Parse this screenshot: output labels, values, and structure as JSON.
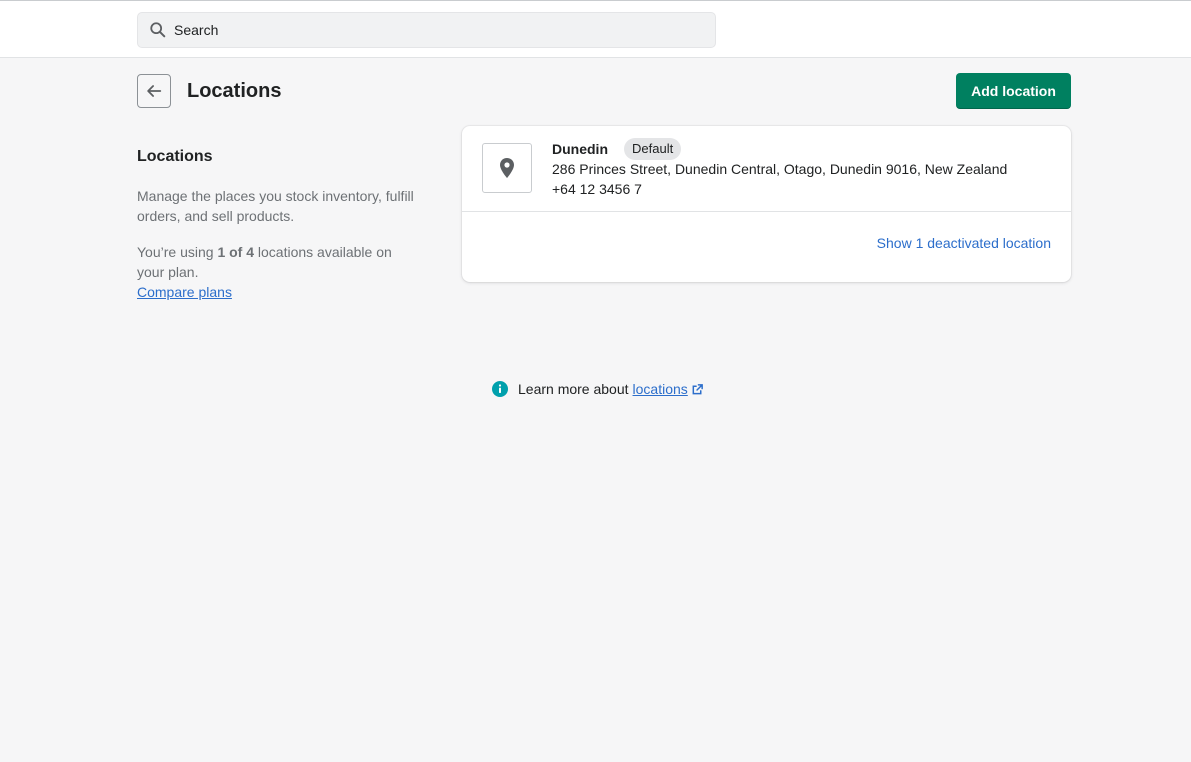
{
  "topbar": {
    "search": {
      "placeholder": "Search",
      "icon": "search-icon"
    }
  },
  "header": {
    "back_icon": "arrow-left-icon",
    "title": "Locations",
    "add_button_label": "Add location"
  },
  "sidebar_info": {
    "heading": "Locations",
    "description": "Manage the places you stock inventory, fulfill orders, and sell products.",
    "usage_prefix": "You’re using ",
    "usage_count": "1 of 4",
    "usage_suffix": " locations available on your plan.",
    "compare_link": "Compare plans"
  },
  "locations": [
    {
      "name": "Dunedin",
      "badge": "Default",
      "address": "286 Princes Street, Dunedin Central, Otago, Dunedin 9016, New Zealand",
      "phone": "+64 12 3456 7",
      "icon": "location-pin-icon"
    }
  ],
  "card_footer": {
    "show_deactivated": "Show 1 deactivated location"
  },
  "learn_more": {
    "prefix": "Learn more about",
    "link": "locations",
    "icon": "info-icon",
    "link_icon": "external-link-icon"
  },
  "colors": {
    "primary": "#008060",
    "link": "#2c6ecb",
    "info": "#00a0ac",
    "background": "#f6f6f7"
  }
}
